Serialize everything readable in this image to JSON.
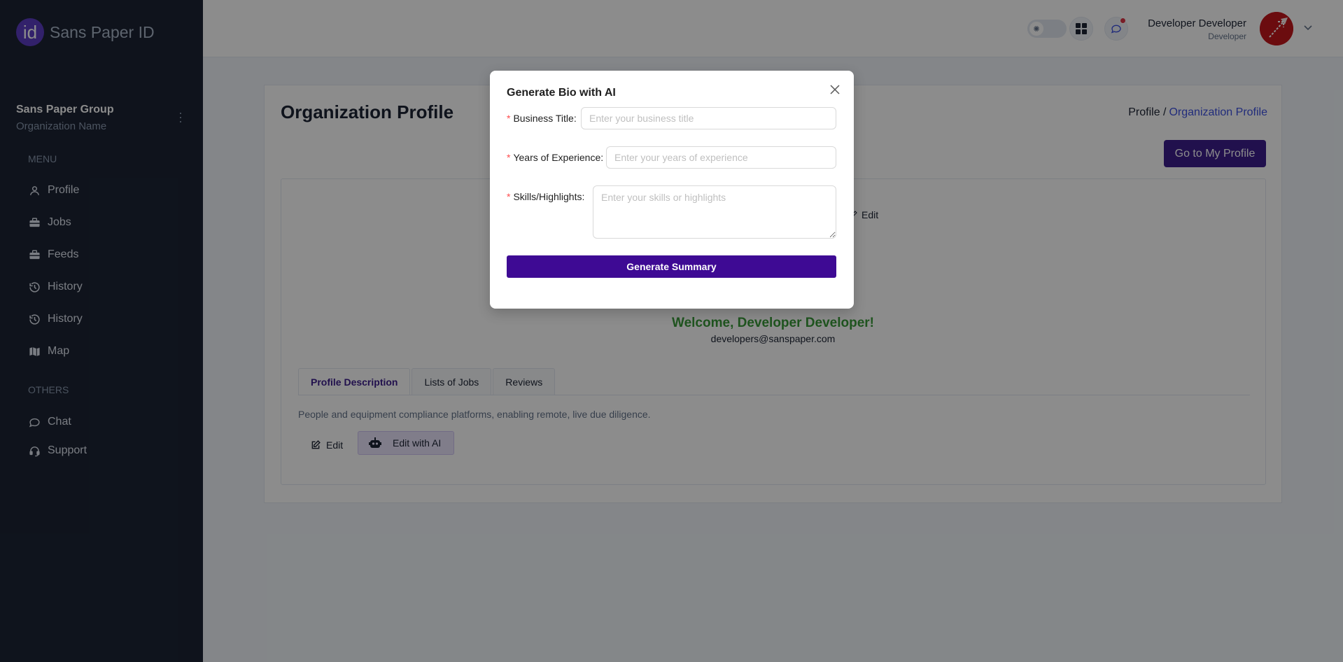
{
  "brand": {
    "logo_text": "id",
    "name": "Sans Paper ID"
  },
  "organization": {
    "title": "Sans Paper Group",
    "subtitle": "Organization Name"
  },
  "sidebar": {
    "menu_heading": "MENU",
    "others_heading": "OTHERS",
    "items": [
      {
        "label": "Profile",
        "icon": "user-icon"
      },
      {
        "label": "Jobs",
        "icon": "briefcase-icon"
      },
      {
        "label": "Feeds",
        "icon": "briefcase-icon"
      },
      {
        "label": "History",
        "icon": "history-icon"
      },
      {
        "label": "History",
        "icon": "history-icon"
      },
      {
        "label": "Map",
        "icon": "map-icon"
      }
    ],
    "others": [
      {
        "label": "Chat",
        "icon": "chat-icon"
      },
      {
        "label": "Support",
        "icon": "headset-icon"
      }
    ]
  },
  "header": {
    "user_name": "Developer Developer",
    "user_role": "Developer"
  },
  "page": {
    "title": "Organization Profile",
    "breadcrumb": {
      "parent": "Profile /",
      "current": "Organization Profile"
    },
    "go_to_profile": "Go to My Profile",
    "cover_edit": "Edit",
    "welcome": "Welcome, Developer Developer!",
    "email": "developers@sanspaper.com",
    "tabs": [
      "Profile Description",
      "Lists of Jobs",
      "Reviews"
    ],
    "description": "People and equipment compliance platforms, enabling remote, live due diligence.",
    "edit_label": "Edit",
    "edit_ai_label": "Edit with AI"
  },
  "modal": {
    "title": "Generate Bio with AI",
    "business_title_label": "Business Title",
    "business_title_placeholder": "Enter your business title",
    "years_label": "Years of Experience",
    "years_placeholder": "Enter your years of experience",
    "skills_label": "Skills/Highlights",
    "skills_placeholder": "Enter your skills or highlights",
    "submit_label": "Generate Summary",
    "required_mark": "*",
    "colon": ":"
  },
  "colors": {
    "sidebar": "#1c2434",
    "accent": "#3e0a94",
    "link": "#3c50e0",
    "success": "#3a9a3a"
  }
}
